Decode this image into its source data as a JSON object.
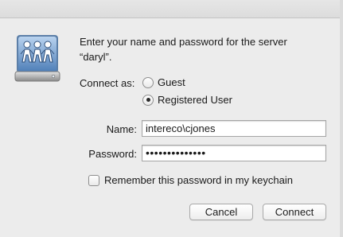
{
  "dialog": {
    "message_line1": "Enter your name and password for the server",
    "message_line2": "“daryl”.",
    "icon": "network-server-icon"
  },
  "connect_as": {
    "label": "Connect as:",
    "options": [
      {
        "label": "Guest",
        "selected": false
      },
      {
        "label": "Registered User",
        "selected": true
      }
    ]
  },
  "fields": {
    "name_label": "Name:",
    "name_value": "intereco\\cjones",
    "password_label": "Password:",
    "password_value": "••••••••••••••"
  },
  "keychain": {
    "label": "Remember this password in my keychain",
    "checked": false
  },
  "buttons": {
    "cancel": "Cancel",
    "connect": "Connect"
  }
}
